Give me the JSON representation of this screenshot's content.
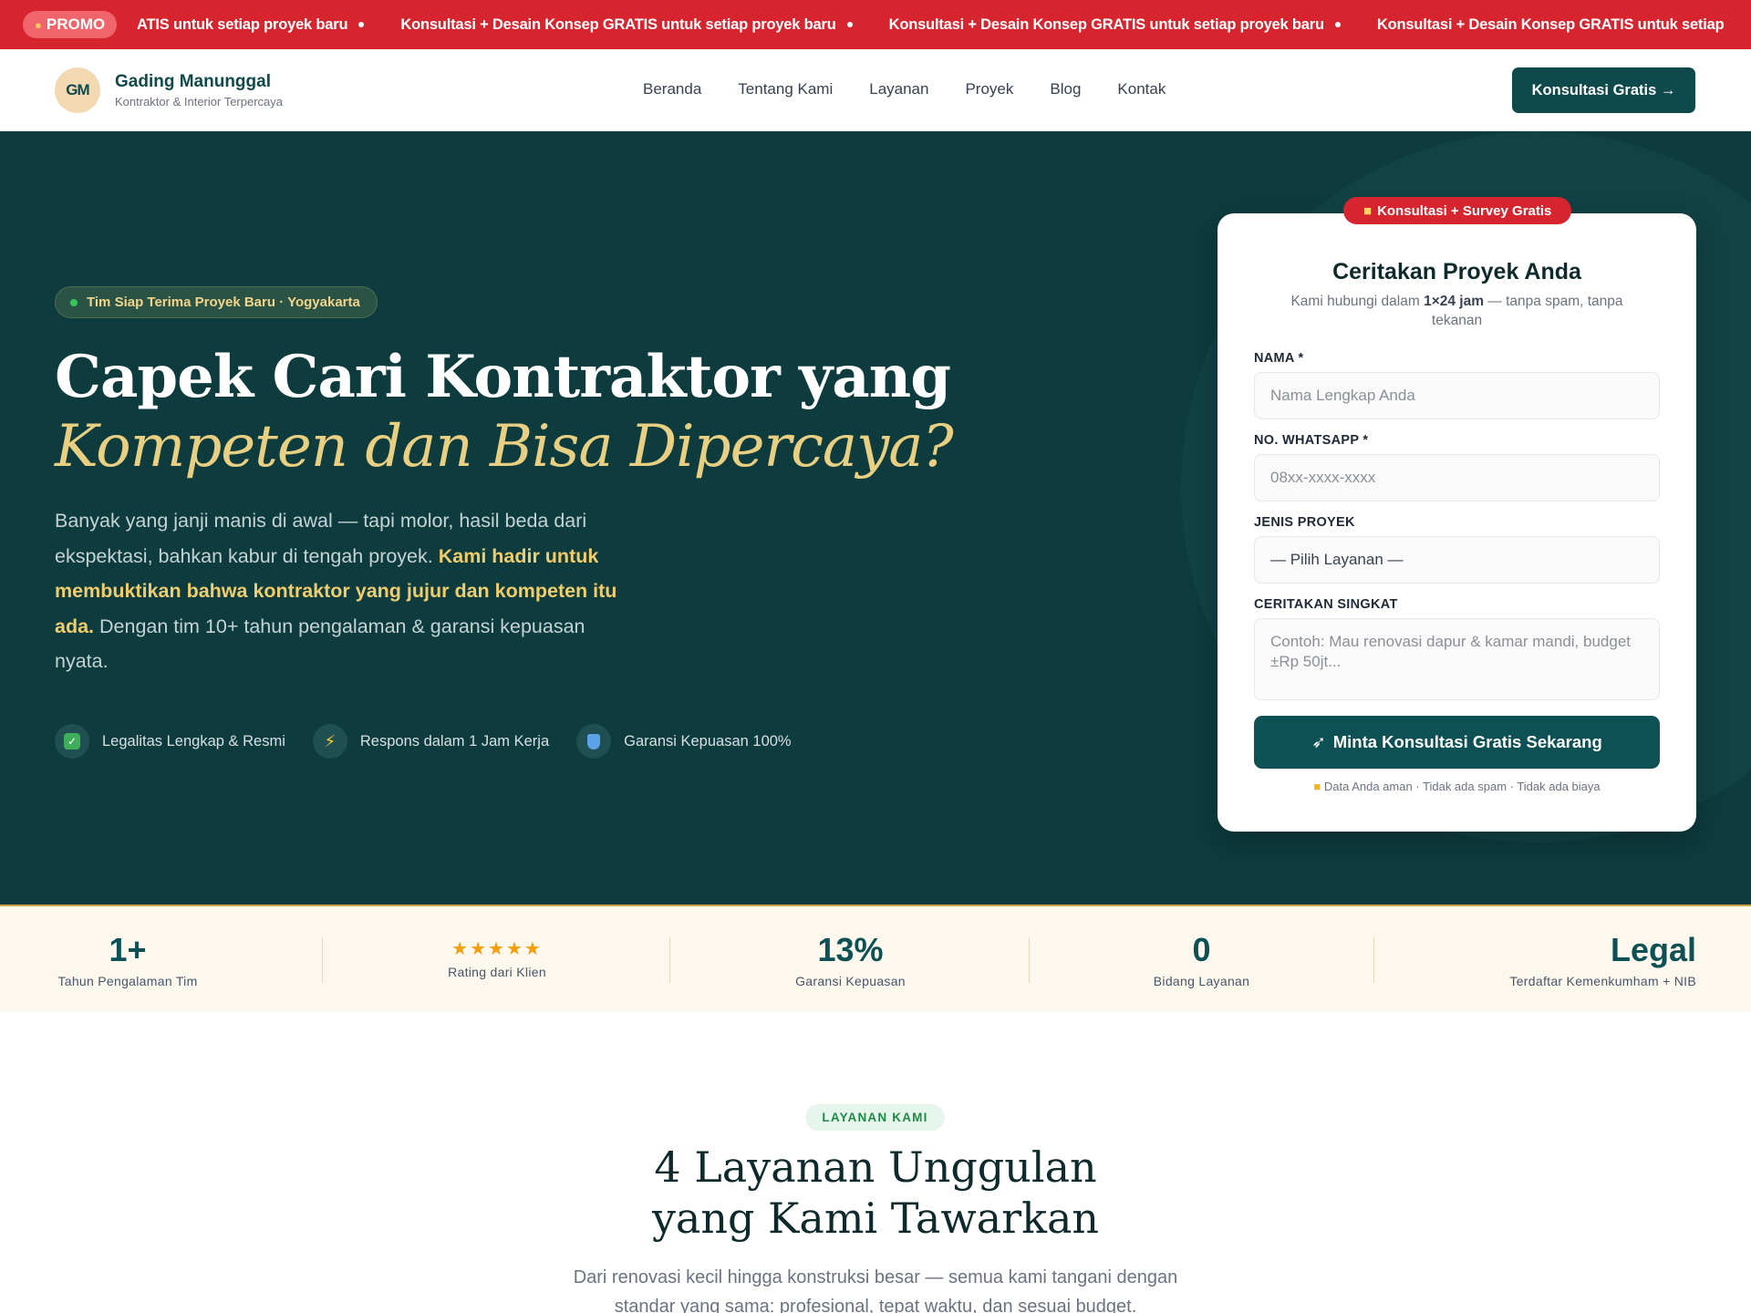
{
  "promo": {
    "label": "PROMO",
    "flame_icon": "flame-icon",
    "first_partial": "ATIS untuk setiap proyek baru",
    "message": "Konsultasi + Desain Konsep GRATIS untuk setiap proyek baru",
    "last_partial": "Konsultasi + Desain Konsep GRATIS untuk setiap"
  },
  "header": {
    "brand_mark": "GM",
    "brand_name": "Gading Manunggal",
    "brand_tagline": "Kontraktor & Interior Terpercaya",
    "nav": [
      "Beranda",
      "Tentang Kami",
      "Layanan",
      "Proyek",
      "Blog",
      "Kontak"
    ],
    "cta": "Konsultasi Gratis →"
  },
  "hero": {
    "badge": "Tim Siap Terima Proyek Baru · Yogyakarta",
    "title_line1": "Capek Cari Kontraktor yang",
    "title_line2": "Kompeten dan Bisa Dipercaya?",
    "lead_part1": "Banyak yang janji manis di awal — tapi molor, hasil beda dari ekspektasi, bahkan kabur di tengah proyek. ",
    "lead_highlight": "Kami hadir untuk membuktikan bahwa kontraktor yang jujur dan kompeten itu ada.",
    "lead_part2": " Dengan tim 10+ tahun pengalaman & garansi kepuasan nyata.",
    "features": [
      {
        "icon": "check-icon",
        "label": "Legalitas Lengkap & Resmi"
      },
      {
        "icon": "bolt-icon",
        "label": "Respons dalam 1 Jam Kerja"
      },
      {
        "icon": "shield-icon",
        "label": "Garansi Kepuasan 100%"
      }
    ]
  },
  "form": {
    "tag": "Konsultasi + Survey Gratis",
    "title": "Ceritakan Proyek Anda",
    "subtitle_a": "Kami hubungi dalam ",
    "subtitle_b": "1×24 jam",
    "subtitle_c": " — tanpa spam, tanpa tekanan",
    "name_label": "NAMA *",
    "name_placeholder": "Nama Lengkap Anda",
    "wa_label": "NO. WHATSAPP *",
    "wa_placeholder": "08xx-xxxx-xxxx",
    "type_label": "JENIS PROYEK",
    "type_value": "— Pilih Layanan —",
    "story_label": "CERITAKAN SINGKAT",
    "story_placeholder": "Contoh: Mau renovasi dapur & kamar mandi, budget ±Rp 50jt...",
    "submit": "Minta Konsultasi Gratis Sekarang",
    "secure": "Data Anda aman · Tidak ada spam · Tidak ada biaya"
  },
  "stats": [
    {
      "value": "1+",
      "label": "Tahun Pengalaman Tim"
    },
    {
      "value": "★★★★★",
      "label": "Rating dari Klien"
    },
    {
      "value": "13%",
      "label": "Garansi Kepuasan"
    },
    {
      "value": "0",
      "label": "Bidang Layanan"
    },
    {
      "value": "Legal",
      "label": "Terdaftar Kemenkumham + NIB"
    }
  ],
  "services": {
    "pill": "LAYANAN KAMI",
    "title_line1": "4 Layanan Unggulan",
    "title_line2": "yang Kami Tawarkan",
    "subtitle": "Dari renovasi kecil hingga konstruksi besar — semua kami tangani dengan standar yang sama: profesional, tepat waktu, dan sesuai budget."
  },
  "colors": {
    "promo_red": "#d7252f",
    "brand_teal": "#0e4a4c",
    "hero_bg": "#0d3b3e",
    "gold": "#e9cf82"
  }
}
